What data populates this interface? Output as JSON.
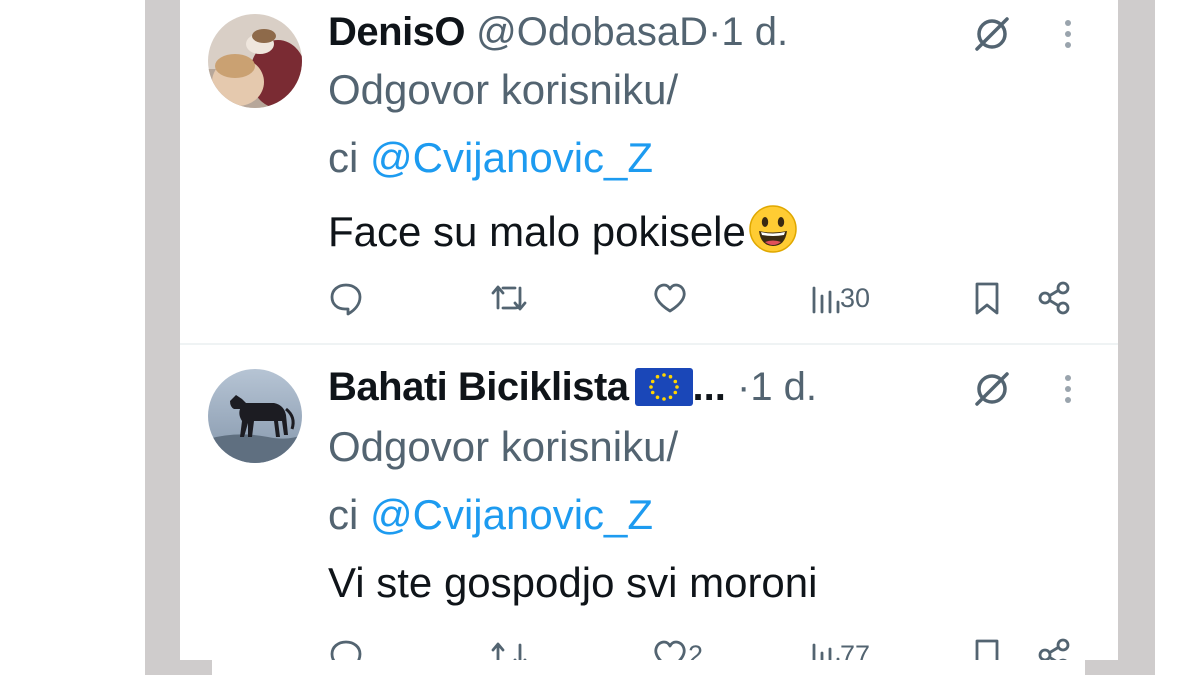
{
  "tweets": [
    {
      "display_name": "DenisO",
      "handle": "@OdobasaD",
      "separator": "·",
      "time": "1 d.",
      "reply_line1": "Odgovor korisniku/",
      "reply_prefix": "ci ",
      "mention": "@Cvijanovic_Z",
      "text": "Face su malo pokisele",
      "views": "30"
    },
    {
      "display_name": "Bahati Biciklista",
      "name_suffix": "...",
      "separator": "·",
      "time": "1 d.",
      "reply_line1": "Odgovor korisniku/",
      "reply_prefix": "ci ",
      "mention": "@Cvijanovic_Z",
      "text": "Vi ste gospodjo svi moroni",
      "likes": "2",
      "views": "77"
    }
  ],
  "colors": {
    "text": "#0f1419",
    "secondary": "#536471",
    "link": "#1d9bf0",
    "frame": "#cfcccc"
  },
  "icons": [
    "grok-icon",
    "more-icon",
    "reply-icon",
    "retweet-icon",
    "like-icon",
    "views-icon",
    "bookmark-icon",
    "share-icon",
    "eu-flag-icon",
    "grinning-emoji-icon"
  ]
}
